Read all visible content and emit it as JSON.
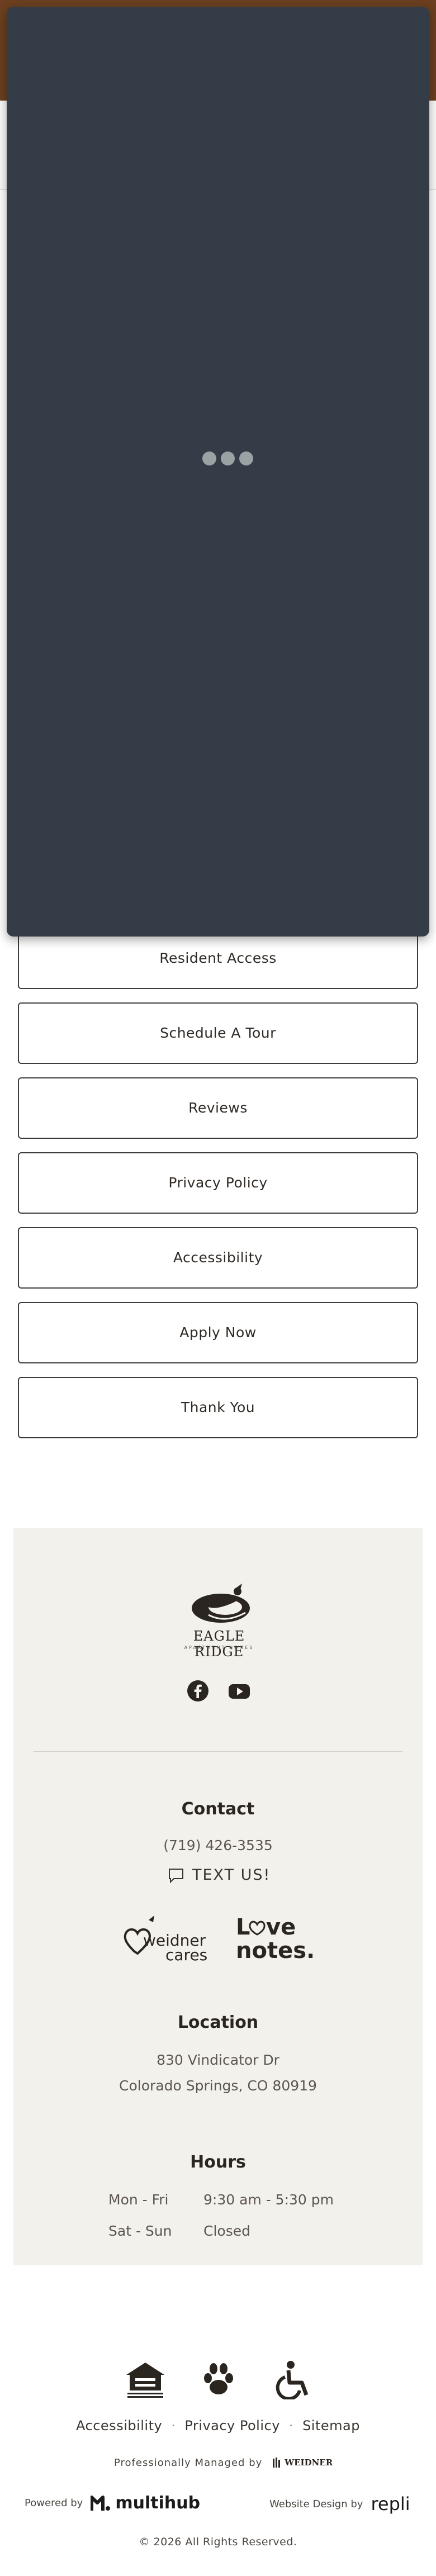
{
  "loader": {
    "dot_color": "#9aa3a3",
    "background": "#343d47"
  },
  "links": [
    "Resident Access",
    "Schedule A Tour",
    "Reviews",
    "Privacy Policy",
    "Accessibility",
    "Apply Now",
    "Thank You"
  ],
  "footer": {
    "logo_text": "EAGLE RIDGE",
    "logo_sub": "APARTMENT HOMES",
    "social": [
      "facebook-icon",
      "youtube-icon"
    ],
    "contact": {
      "title": "Contact",
      "phone": "(719) 426-3535",
      "text_us": "TEXT US!"
    },
    "partners": {
      "weidner_cares": "weidner cares",
      "love_notes": "Love notes."
    },
    "location": {
      "title": "Location",
      "line1": "830 Vindicator Dr",
      "line2": "Colorado Springs, CO 80919"
    },
    "hours": {
      "title": "Hours",
      "rows": [
        {
          "day": "Mon - Fri",
          "time": "9:30 am - 5:30 pm"
        },
        {
          "day": "Sat - Sun",
          "time": "Closed"
        }
      ]
    }
  },
  "bottom": {
    "icons": [
      "equal-housing-icon",
      "pet-friendly-icon",
      "accessibility-icon"
    ],
    "links": [
      "Accessibility",
      "Privacy Policy",
      "Sitemap"
    ],
    "managed_label": "Professionally Managed by",
    "managed_brand": "WEIDNER",
    "powered_label": "Powered by",
    "powered_brand": "multihub",
    "design_label": "Website Design by",
    "design_brand": "repli",
    "copyright": "© 2026 All Rights Reserved."
  }
}
